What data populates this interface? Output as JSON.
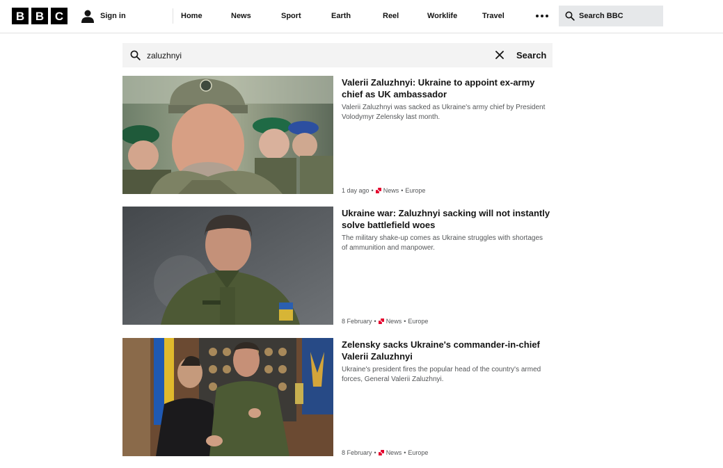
{
  "header": {
    "logo_letters": [
      "B",
      "B",
      "C"
    ],
    "signin_label": "Sign in",
    "nav": [
      "Home",
      "News",
      "Sport",
      "Earth",
      "Reel",
      "Worklife",
      "Travel"
    ],
    "search_label": "Search BBC"
  },
  "search": {
    "query": "zaluzhnyi",
    "button_label": "Search"
  },
  "results": [
    {
      "title": "Valerii Zaluzhnyi: Ukraine to appoint ex-army chief as UK ambassador",
      "description": "Valerii Zaluzhnyi was sacked as Ukraine's army chief by President Volodymyr Zelensky last month.",
      "time": "1 day ago",
      "section": "News",
      "subsection": "Europe"
    },
    {
      "title": "Ukraine war: Zaluzhnyi sacking will not instantly solve battlefield woes",
      "description": "The military shake-up comes as Ukraine struggles with shortages of ammunition and manpower.",
      "time": "8 February",
      "section": "News",
      "subsection": "Europe"
    },
    {
      "title": "Zelensky sacks Ukraine's commander-in-chief Valerii Zaluzhnyi",
      "description": "Ukraine's president fires the popular head of the country's armed forces, General Valerii Zaluzhnyi.",
      "time": "8 February",
      "section": "News",
      "subsection": "Europe"
    }
  ],
  "colors": {
    "news_mark": "#e4002b",
    "text": "#141414",
    "muted": "#545658",
    "search_bg": "#f3f3f3"
  },
  "icons": {
    "user": "user-icon",
    "search": "search-icon",
    "clear": "close-icon",
    "more": "more-dots-icon"
  }
}
